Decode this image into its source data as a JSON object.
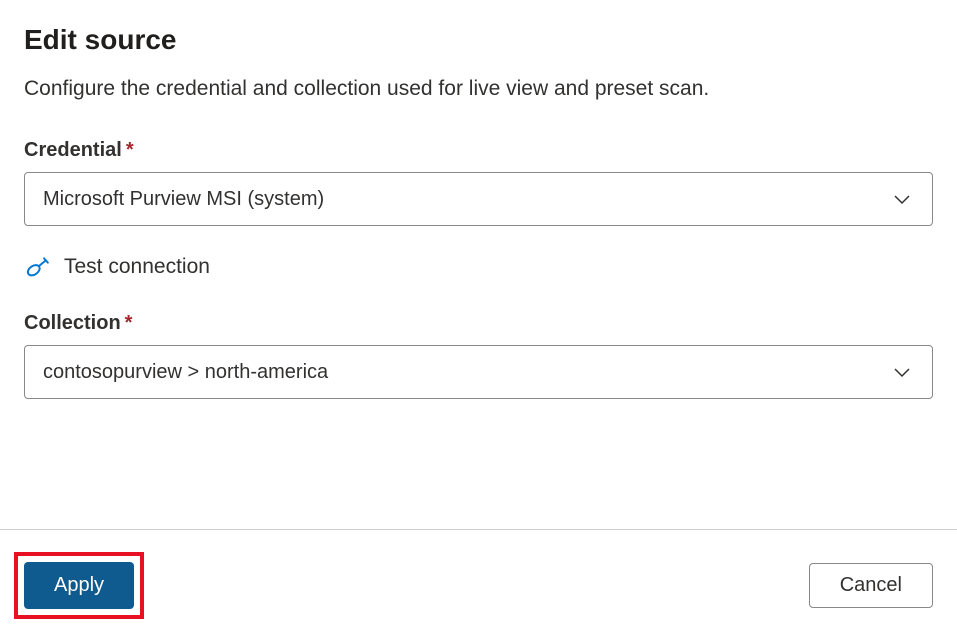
{
  "header": {
    "title": "Edit source",
    "description": "Configure the credential and collection used for live view and preset scan."
  },
  "form": {
    "credential": {
      "label": "Credential",
      "required": "*",
      "value": "Microsoft Purview MSI (system)"
    },
    "test_connection": {
      "label": "Test connection"
    },
    "collection": {
      "label": "Collection",
      "required": "*",
      "value": "contosopurview > north-america"
    }
  },
  "footer": {
    "apply_label": "Apply",
    "cancel_label": "Cancel"
  }
}
